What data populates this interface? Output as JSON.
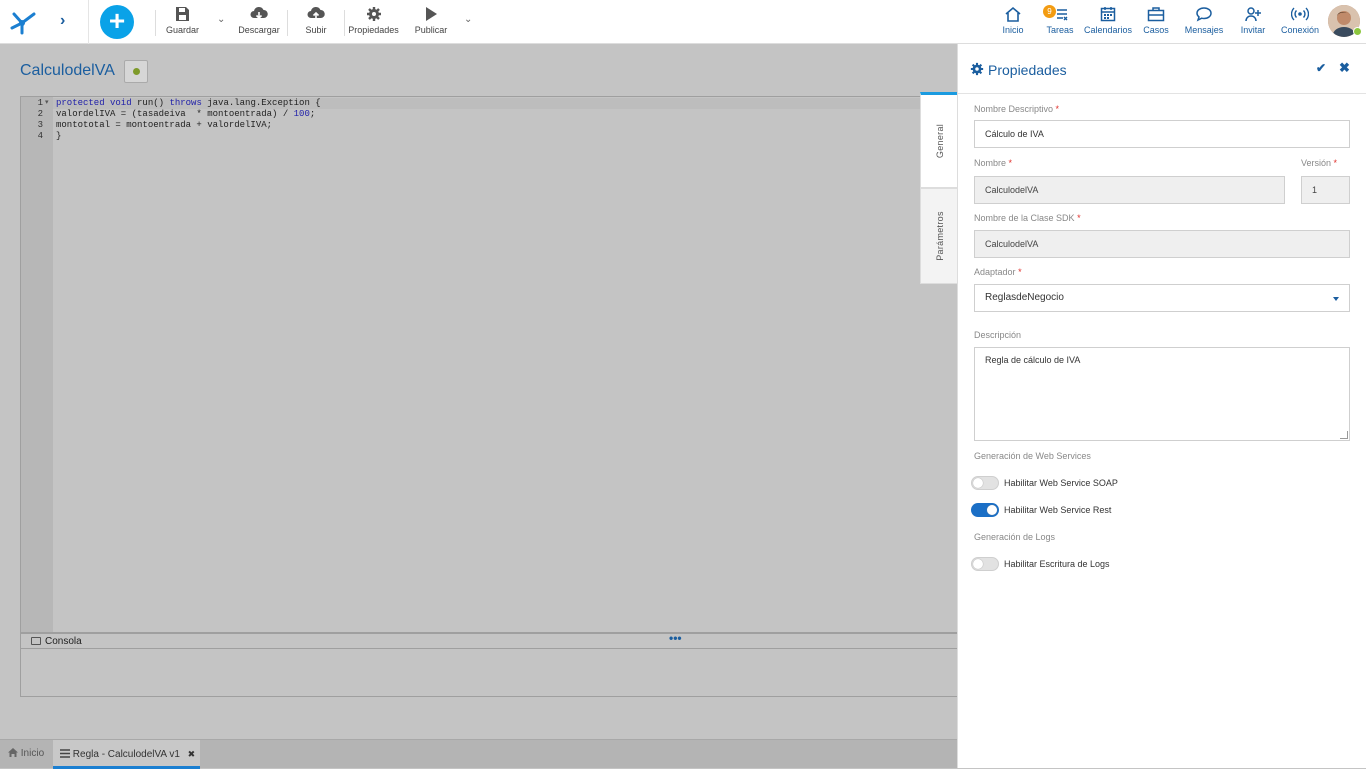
{
  "toolbar": {
    "guardar": "Guardar",
    "descargar": "Descargar",
    "subir": "Subir",
    "propiedades": "Propiedades",
    "publicar": "Publicar"
  },
  "nav": {
    "inicio": "Inicio",
    "tareas": "Tareas",
    "tareas_badge": "9",
    "calendarios": "Calendarios",
    "casos": "Casos",
    "mensajes": "Mensajes",
    "invitar": "Invitar",
    "conexion": "Conexión"
  },
  "page_title": "CalculodelVA",
  "editor": {
    "lines": [
      {
        "num": "1",
        "pre_kw": "protected void",
        "mid": " run() ",
        "kw2": "throws",
        "rest": " java.lang.Exception {"
      },
      {
        "num": "2",
        "text": "valordelIVA = (tasadeiva  * montoentrada) / ",
        "num_lit": "100",
        "tail": ";"
      },
      {
        "num": "3",
        "text": "montototal = montoentrada + valordelIVA;"
      },
      {
        "num": "4",
        "text": "}"
      }
    ]
  },
  "console": {
    "title": "Consola",
    "dots": "•••"
  },
  "tabs": {
    "inicio": "Inicio",
    "regla": "Regla - CalculodelVA v1",
    "close": "✖"
  },
  "panel": {
    "title": "Propiedades",
    "ok": "✔",
    "close": "✖",
    "vtabs": {
      "general": "General",
      "parametros": "Parámetros"
    },
    "required_mark": "*",
    "nombre_descriptivo_label": "Nombre Descriptivo",
    "nombre_descriptivo_value": "Cálculo de IVA",
    "nombre_label": "Nombre",
    "nombre_value": "CalculodelVA",
    "version_label": "Versión",
    "version_value": "1",
    "clase_sdk_label": "Nombre de la Clase SDK",
    "clase_sdk_value": "CalculodelVA",
    "adaptador_label": "Adaptador",
    "adaptador_value": "ReglasdeNegocio",
    "descripcion_label": "Descripción",
    "descripcion_value": "Regla de cálculo de IVA",
    "ws_section": "Generación de Web Services",
    "soap_label": "Habilitar Web Service SOAP",
    "soap_on": false,
    "rest_label": "Habilitar Web Service Rest",
    "rest_on": true,
    "logs_section": "Generación de Logs",
    "logs_label": "Habilitar Escritura de Logs",
    "logs_on": false
  },
  "colors": {
    "accent": "#1b5e9f",
    "add_button": "#0aa2e8",
    "badge": "#f39c12",
    "toggle_on": "#1b6fc6"
  }
}
